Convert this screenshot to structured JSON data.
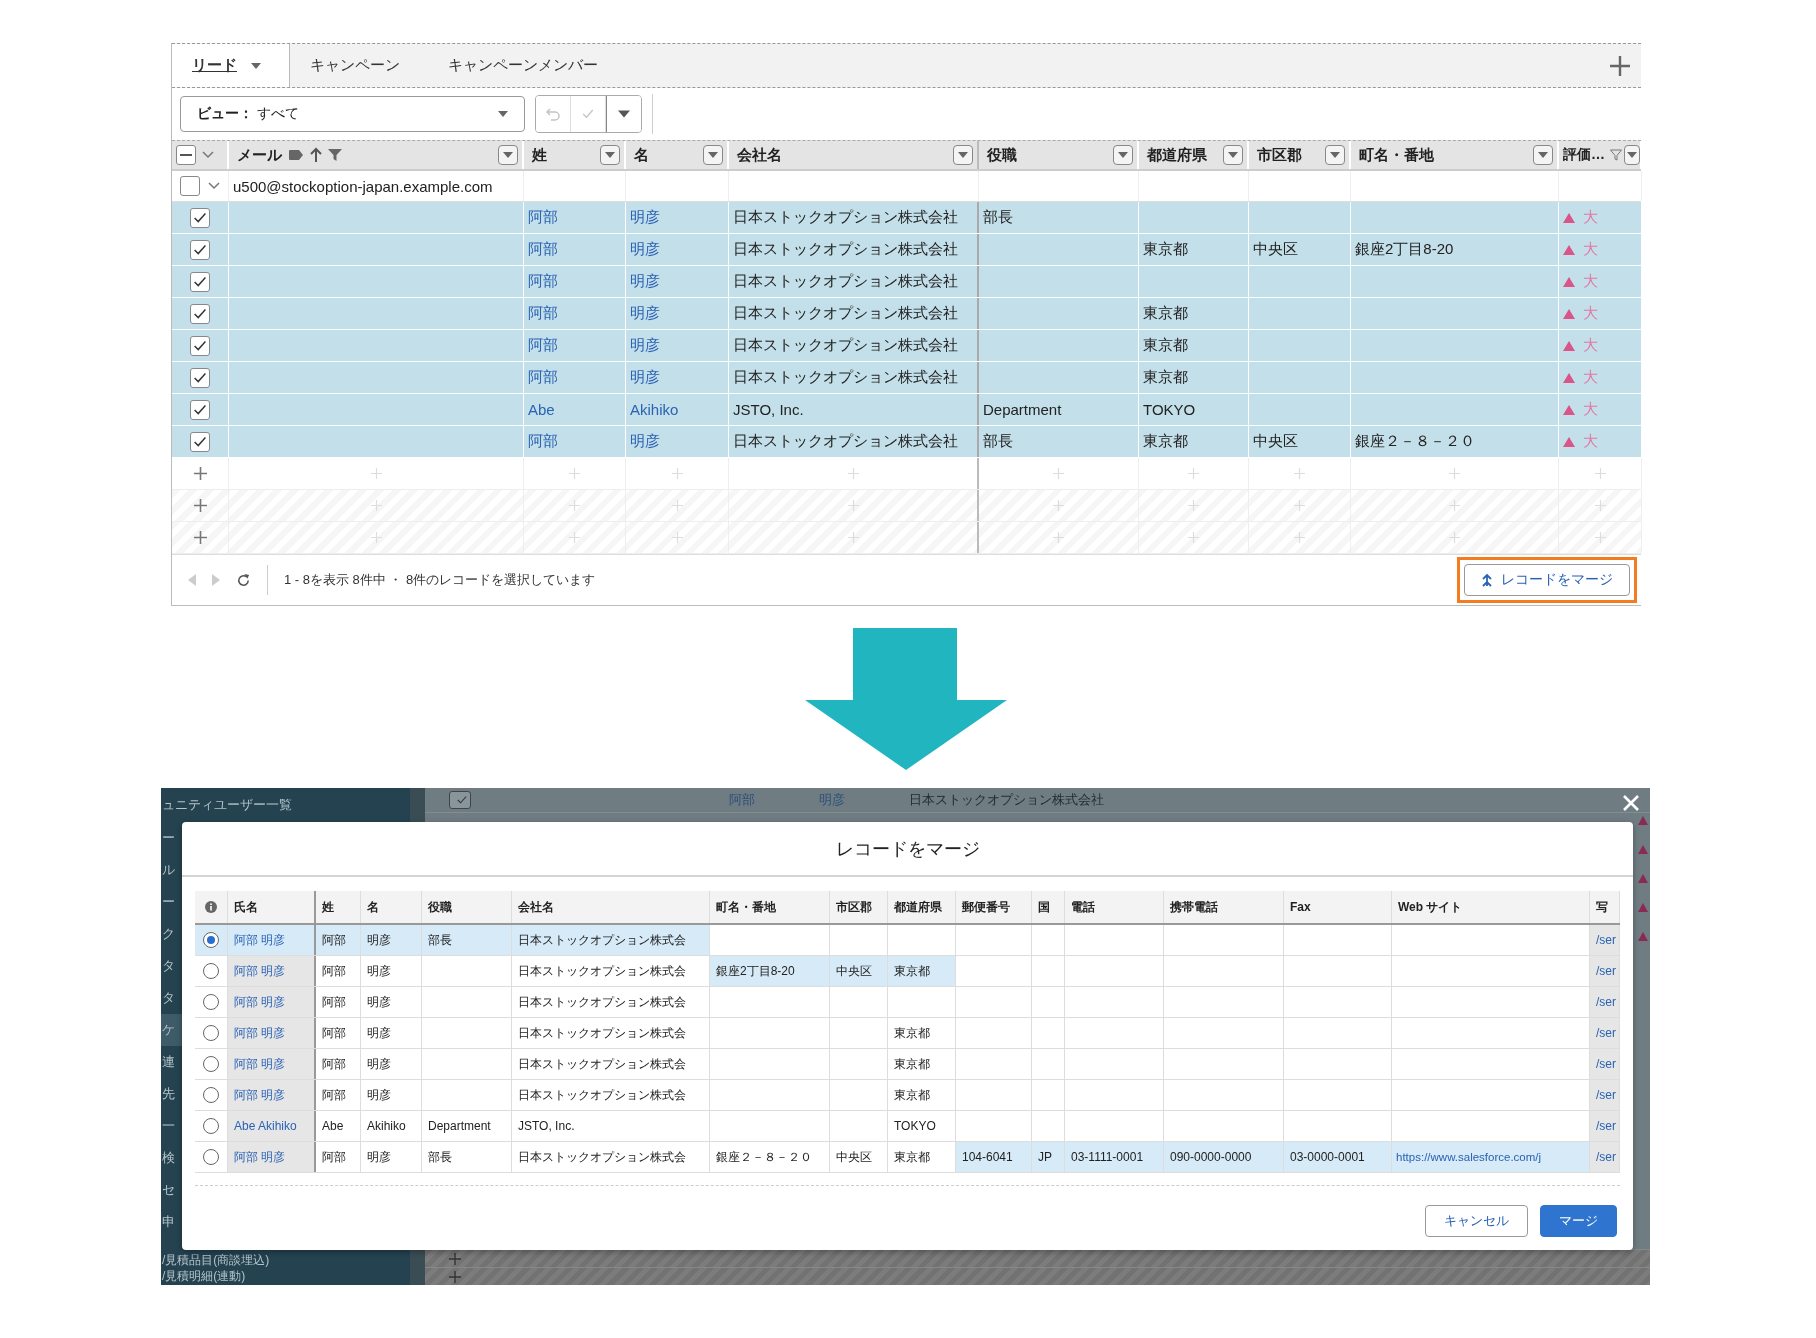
{
  "leads_view": {
    "tabs": [
      {
        "label": "リード",
        "selected": true
      },
      {
        "label": "キャンペーン",
        "selected": false
      },
      {
        "label": "キャンペーンメンバー",
        "selected": false
      }
    ],
    "view_select": {
      "label": "ビュー：",
      "value": "すべて"
    },
    "toolbar_buttons": [
      {
        "kind": "undo",
        "disabled": true
      },
      {
        "kind": "confirm",
        "disabled": true
      },
      {
        "kind": "menu",
        "disabled": false
      }
    ],
    "header_checkbox": {
      "indeterminate": true
    },
    "columns": [
      "メール",
      "姓",
      "名",
      "会社名",
      "役職",
      "都道府県",
      "市区郡",
      "町名・番地",
      "評価…"
    ],
    "group": {
      "label": "u500@stockoption-japan.example.com",
      "checked": false,
      "expanded": true
    },
    "rows": [
      {
        "checked": true,
        "last_name": "阿部",
        "first_name": "明彦",
        "company": "日本ストックオプション株式会社",
        "title": "部長",
        "rating": "大"
      },
      {
        "checked": true,
        "last_name": "阿部",
        "first_name": "明彦",
        "company": "日本ストックオプション株式会社",
        "prefecture": "東京都",
        "city": "中央区",
        "street": "銀座2丁目8-20",
        "rating": "大"
      },
      {
        "checked": true,
        "last_name": "阿部",
        "first_name": "明彦",
        "company": "日本ストックオプション株式会社",
        "rating": "大"
      },
      {
        "checked": true,
        "last_name": "阿部",
        "first_name": "明彦",
        "company": "日本ストックオプション株式会社",
        "prefecture": "東京都",
        "rating": "大"
      },
      {
        "checked": true,
        "last_name": "阿部",
        "first_name": "明彦",
        "company": "日本ストックオプション株式会社",
        "prefecture": "東京都",
        "rating": "大"
      },
      {
        "checked": true,
        "last_name": "阿部",
        "first_name": "明彦",
        "company": "日本ストックオプション株式会社",
        "prefecture": "東京都",
        "rating": "大"
      },
      {
        "checked": true,
        "last_name": "Abe",
        "first_name": "Akihiko",
        "company": "JSTO, Inc.",
        "title": "Department",
        "prefecture": "TOKYO",
        "rating": "大"
      },
      {
        "checked": true,
        "last_name": "阿部",
        "first_name": "明彦",
        "company": "日本ストックオプション株式会社",
        "title": "部長",
        "prefecture": "東京都",
        "city": "中央区",
        "street": "銀座２－８－２０",
        "rating": "大"
      }
    ],
    "blank_rows": [
      {
        "kind": "add"
      },
      {
        "kind": "add"
      },
      {
        "kind": "add"
      }
    ],
    "status": "1 - 8を表示 8件中 ・ 8件のレコードを選択しています",
    "merge_button": {
      "label": "レコードをマージ",
      "highlighted": true
    }
  },
  "merge_screen": {
    "sidebar": [
      {
        "label": "ュニティユーザー一覧",
        "selected": false
      },
      {
        "label": "ー",
        "selected": false
      },
      {
        "label": "ル",
        "selected": false
      },
      {
        "label": "ー",
        "selected": false
      },
      {
        "label": "ク",
        "selected": false
      },
      {
        "label": "タ",
        "selected": false
      },
      {
        "label": "タ",
        "selected": false
      },
      {
        "label": "ケ",
        "selected": true
      },
      {
        "label": "連",
        "selected": false
      },
      {
        "label": "先",
        "selected": false
      },
      {
        "label": "一",
        "selected": false
      },
      {
        "label": "検",
        "selected": false
      },
      {
        "label": "セ",
        "selected": false
      },
      {
        "label": "申",
        "selected": false
      },
      {
        "label": "/見積品目(商談埋込)",
        "selected": false
      },
      {
        "label": "/見積明細(連動)",
        "selected": false
      }
    ],
    "background_row": {
      "checked": true,
      "last_name": "阿部",
      "first_name": "明彦",
      "company": "日本ストックオプション株式会社"
    },
    "dialog": {
      "title": "レコードをマージ",
      "columns": [
        "氏名",
        "姓",
        "名",
        "役職",
        "会社名",
        "町名・番地",
        "市区郡",
        "都道府県",
        "郵便番号",
        "国",
        "電話",
        "携帯電話",
        "Fax",
        "Web サイト",
        "写"
      ],
      "rows": [
        {
          "selected": true,
          "cells": [
            {
              "text": "阿部 明彦",
              "highlighted": true
            },
            {
              "text": "阿部",
              "highlighted": true
            },
            {
              "text": "明彦",
              "highlighted": true
            },
            {
              "text": "部長",
              "highlighted": true
            },
            {
              "text": "日本ストックオプション株式会",
              "highlighted": true
            },
            {
              "highlighted": false
            },
            {
              "highlighted": false
            },
            {
              "highlighted": false
            },
            {
              "highlighted": false
            },
            {
              "highlighted": false
            },
            {
              "highlighted": false
            },
            {
              "highlighted": false
            },
            {
              "highlighted": false
            },
            {
              "highlighted": false
            },
            {
              "text": "/ser",
              "highlighted": false
            }
          ]
        },
        {
          "selected": false,
          "cells": [
            {
              "text": "阿部 明彦",
              "highlighted": false
            },
            {
              "text": "阿部",
              "highlighted": false
            },
            {
              "text": "明彦",
              "highlighted": false
            },
            {
              "highlighted": false
            },
            {
              "text": "日本ストックオプション株式会",
              "highlighted": false
            },
            {
              "text": "銀座2丁目8-20",
              "highlighted": true
            },
            {
              "text": "中央区",
              "highlighted": true
            },
            {
              "text": "東京都",
              "highlighted": true
            },
            {
              "highlighted": false
            },
            {
              "highlighted": false
            },
            {
              "highlighted": false
            },
            {
              "highlighted": false
            },
            {
              "highlighted": false
            },
            {
              "highlighted": false
            },
            {
              "text": "/ser",
              "highlighted": false
            }
          ]
        },
        {
          "selected": false,
          "cells": [
            {
              "text": "阿部 明彦",
              "highlighted": false
            },
            {
              "text": "阿部",
              "highlighted": false
            },
            {
              "text": "明彦",
              "highlighted": false
            },
            {
              "highlighted": false
            },
            {
              "text": "日本ストックオプション株式会",
              "highlighted": false
            },
            {
              "highlighted": false
            },
            {
              "highlighted": false
            },
            {
              "highlighted": false
            },
            {
              "highlighted": false
            },
            {
              "highlighted": false
            },
            {
              "highlighted": false
            },
            {
              "highlighted": false
            },
            {
              "highlighted": false
            },
            {
              "highlighted": false
            },
            {
              "text": "/ser",
              "highlighted": false
            }
          ]
        },
        {
          "selected": false,
          "cells": [
            {
              "text": "阿部 明彦",
              "highlighted": false
            },
            {
              "text": "阿部",
              "highlighted": false
            },
            {
              "text": "明彦",
              "highlighted": false
            },
            {
              "highlighted": false
            },
            {
              "text": "日本ストックオプション株式会",
              "highlighted": false
            },
            {
              "highlighted": false
            },
            {
              "highlighted": false
            },
            {
              "text": "東京都",
              "highlighted": false
            },
            {
              "highlighted": false
            },
            {
              "highlighted": false
            },
            {
              "highlighted": false
            },
            {
              "highlighted": false
            },
            {
              "highlighted": false
            },
            {
              "highlighted": false
            },
            {
              "text": "/ser",
              "highlighted": false
            }
          ]
        },
        {
          "selected": false,
          "cells": [
            {
              "text": "阿部 明彦",
              "highlighted": false
            },
            {
              "text": "阿部",
              "highlighted": false
            },
            {
              "text": "明彦",
              "highlighted": false
            },
            {
              "highlighted": false
            },
            {
              "text": "日本ストックオプション株式会",
              "highlighted": false
            },
            {
              "highlighted": false
            },
            {
              "highlighted": false
            },
            {
              "text": "東京都",
              "highlighted": false
            },
            {
              "highlighted": false
            },
            {
              "highlighted": false
            },
            {
              "highlighted": false
            },
            {
              "highlighted": false
            },
            {
              "highlighted": false
            },
            {
              "highlighted": false
            },
            {
              "text": "/ser",
              "highlighted": false
            }
          ]
        },
        {
          "selected": false,
          "cells": [
            {
              "text": "阿部 明彦",
              "highlighted": false
            },
            {
              "text": "阿部",
              "highlighted": false
            },
            {
              "text": "明彦",
              "highlighted": false
            },
            {
              "highlighted": false
            },
            {
              "text": "日本ストックオプション株式会",
              "highlighted": false
            },
            {
              "highlighted": false
            },
            {
              "highlighted": false
            },
            {
              "text": "東京都",
              "highlighted": false
            },
            {
              "highlighted": false
            },
            {
              "highlighted": false
            },
            {
              "highlighted": false
            },
            {
              "highlighted": false
            },
            {
              "highlighted": false
            },
            {
              "highlighted": false
            },
            {
              "text": "/ser",
              "highlighted": false
            }
          ]
        },
        {
          "selected": false,
          "cells": [
            {
              "text": "Abe Akihiko",
              "highlighted": false
            },
            {
              "text": "Abe",
              "highlighted": false
            },
            {
              "text": "Akihiko",
              "highlighted": false
            },
            {
              "text": "Department",
              "highlighted": false
            },
            {
              "text": "JSTO, Inc.",
              "highlighted": false
            },
            {
              "highlighted": false
            },
            {
              "highlighted": false
            },
            {
              "text": "TOKYO",
              "highlighted": false
            },
            {
              "highlighted": false
            },
            {
              "highlighted": false
            },
            {
              "highlighted": false
            },
            {
              "highlighted": false
            },
            {
              "highlighted": false
            },
            {
              "highlighted": false
            },
            {
              "text": "/ser",
              "highlighted": false
            }
          ]
        },
        {
          "selected": false,
          "cells": [
            {
              "text": "阿部 明彦",
              "highlighted": false
            },
            {
              "text": "阿部",
              "highlighted": false
            },
            {
              "text": "明彦",
              "highlighted": false
            },
            {
              "text": "部長",
              "highlighted": false
            },
            {
              "text": "日本ストックオプション株式会",
              "highlighted": false
            },
            {
              "text": "銀座２－８－２０",
              "highlighted": false
            },
            {
              "text": "中央区",
              "highlighted": false
            },
            {
              "text": "東京都",
              "highlighted": false
            },
            {
              "text": "104-6041",
              "highlighted": true
            },
            {
              "text": "JP",
              "highlighted": true
            },
            {
              "text": "03-1111-0001",
              "highlighted": true
            },
            {
              "text": "090-0000-0000",
              "highlighted": true
            },
            {
              "text": "03-0000-0001",
              "highlighted": true
            },
            {
              "text": "https://www.salesforce.com/j",
              "highlighted": true
            },
            {
              "text": "/ser",
              "highlighted": false
            }
          ]
        }
      ],
      "buttons": [
        {
          "label": "キャンセル",
          "kind": "secondary"
        },
        {
          "label": "マージ",
          "kind": "primary"
        }
      ]
    }
  }
}
